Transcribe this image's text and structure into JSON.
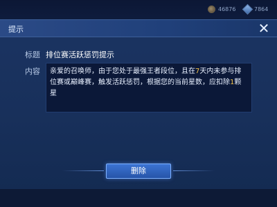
{
  "currency": {
    "gold_amount": "46876",
    "gem_amount": "7864"
  },
  "dialog": {
    "title": "提示",
    "close_icon": "close-icon",
    "title_label": "标题",
    "title_value": "排位赛活跃惩罚提示",
    "content_label": "内容",
    "content_parts": {
      "p1": "亲爱的召唤师，由于您处于最强王者段位，且在",
      "n1": "7",
      "p2": "天内未参与排位赛或巅峰赛，触发活跃惩罚，根据您的当前星数，应扣除",
      "n2": "1",
      "p3": "颗星"
    },
    "delete_label": "删除"
  },
  "colors": {
    "highlight": "#f2c24b",
    "dialog_bg": "#18305b",
    "button_bg": "#2654a8"
  }
}
